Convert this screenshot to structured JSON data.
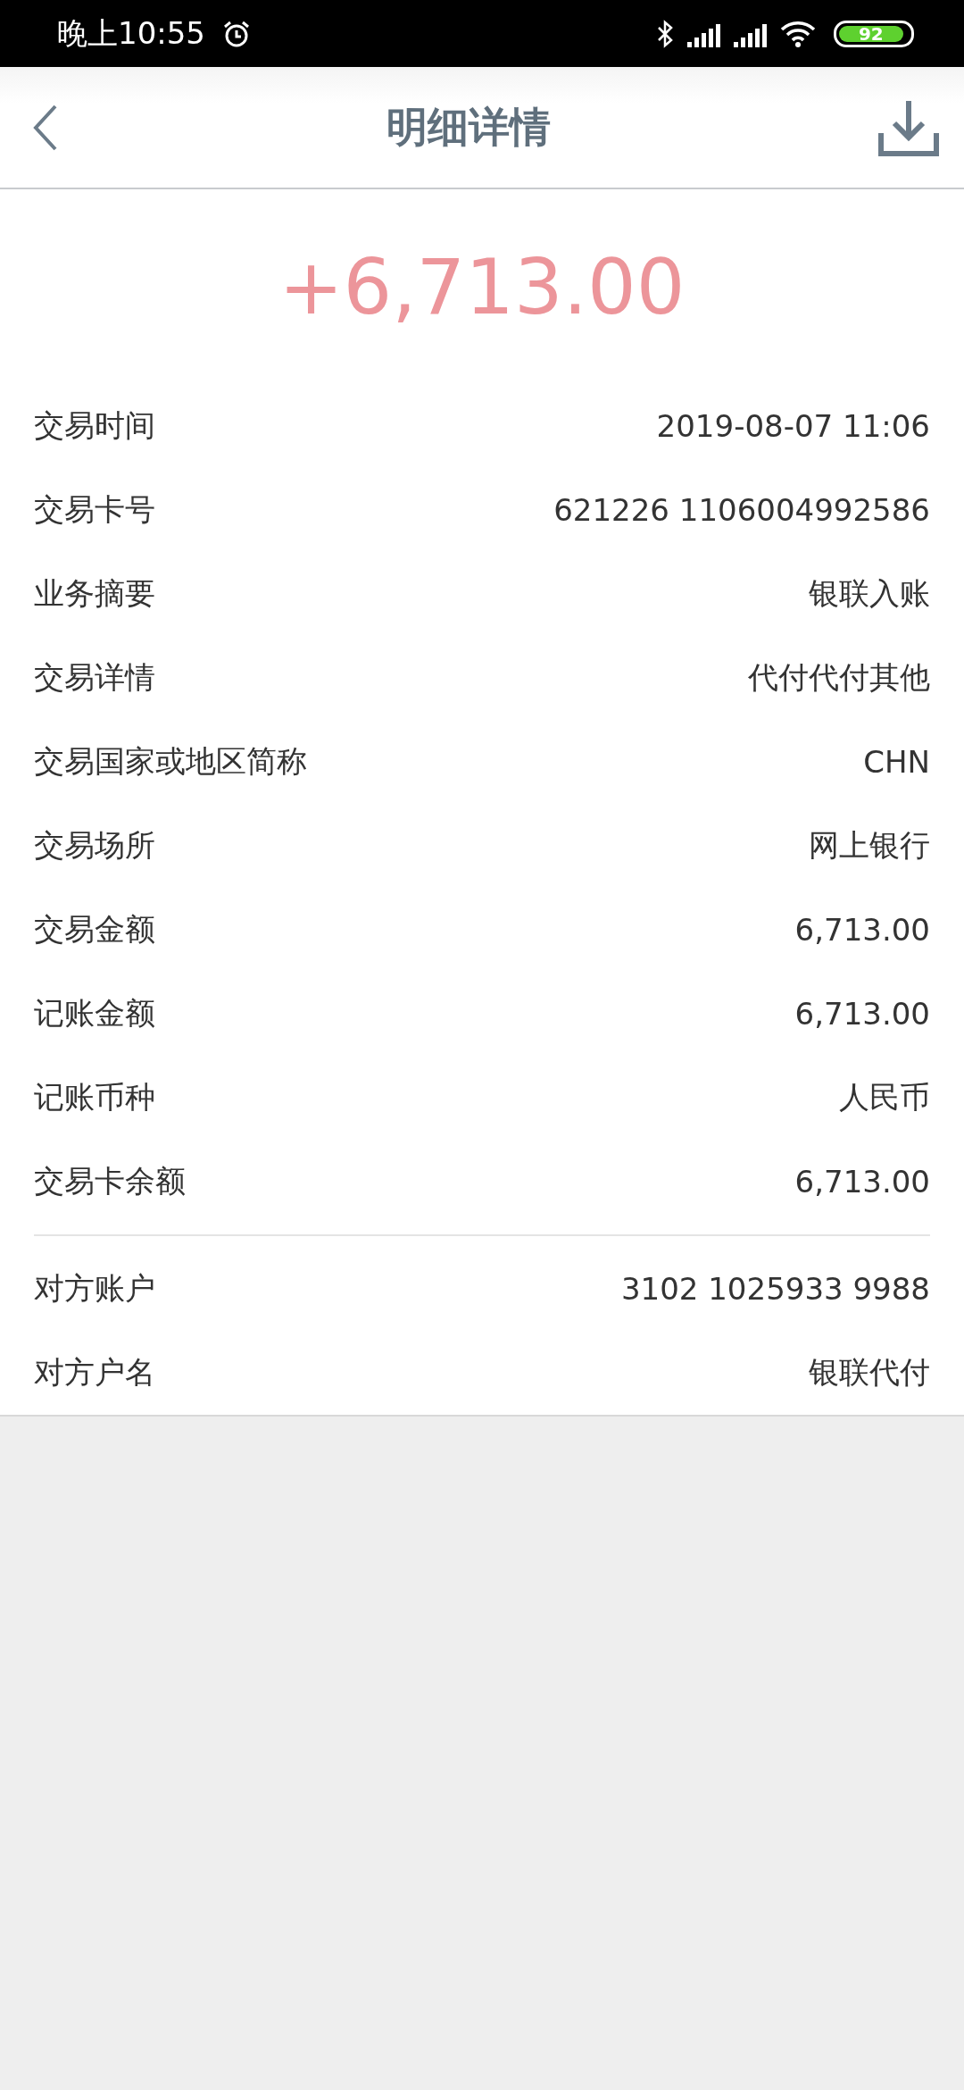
{
  "status_bar": {
    "time": "晚上10:55",
    "battery": "92"
  },
  "header": {
    "title": "明细详情"
  },
  "amount": "+6,713.00",
  "sections": [
    {
      "rows": [
        {
          "label": "交易时间",
          "value": "2019-08-07 11:06"
        },
        {
          "label": "交易卡号",
          "value": "621226 1106004992586"
        },
        {
          "label": "业务摘要",
          "value": "银联入账"
        },
        {
          "label": "交易详情",
          "value": "代付代付其他"
        },
        {
          "label": "交易国家或地区简称",
          "value": "CHN"
        },
        {
          "label": "交易场所",
          "value": "网上银行"
        },
        {
          "label": "交易金额",
          "value": "6,713.00"
        },
        {
          "label": "记账金额",
          "value": "6,713.00"
        },
        {
          "label": "记账币种",
          "value": "人民币"
        },
        {
          "label": "交易卡余额",
          "value": "6,713.00"
        }
      ]
    },
    {
      "rows": [
        {
          "label": "对方账户",
          "value": "3102 1025933 9988"
        },
        {
          "label": "对方户名",
          "value": "银联代付"
        }
      ]
    }
  ]
}
